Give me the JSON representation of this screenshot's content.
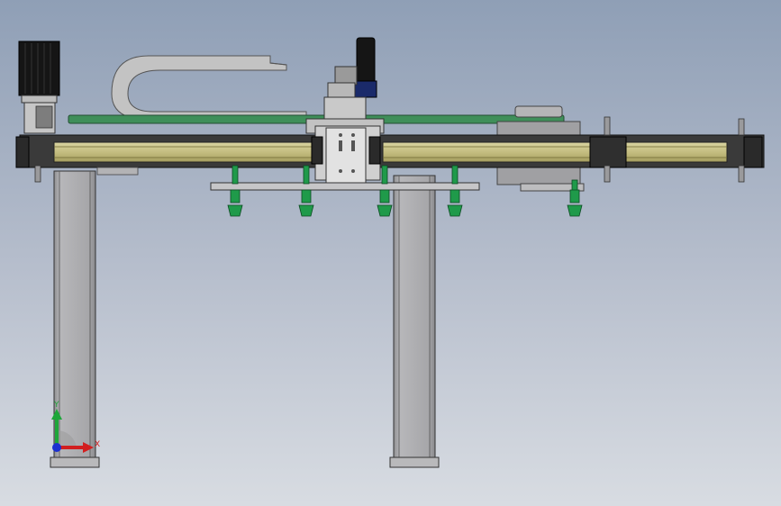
{
  "view": {
    "background_top": "#8f9fb6",
    "background_bottom": "#d8dce2"
  },
  "triad": {
    "x_label": "X",
    "y_label": "Y",
    "x_color": "#d21f1f",
    "y_color": "#1ea63a",
    "z_color": "#1b2fd0"
  },
  "colors": {
    "rail_yellow": "#c9c38a",
    "rail_dark": "#2a2a2a",
    "carriage_grey": "#c8c8c8",
    "pcb_green": "#3f8f5a",
    "suction_green": "#1f9a4a",
    "motor_black": "#151515",
    "column_grey": "#a9a9ab"
  }
}
